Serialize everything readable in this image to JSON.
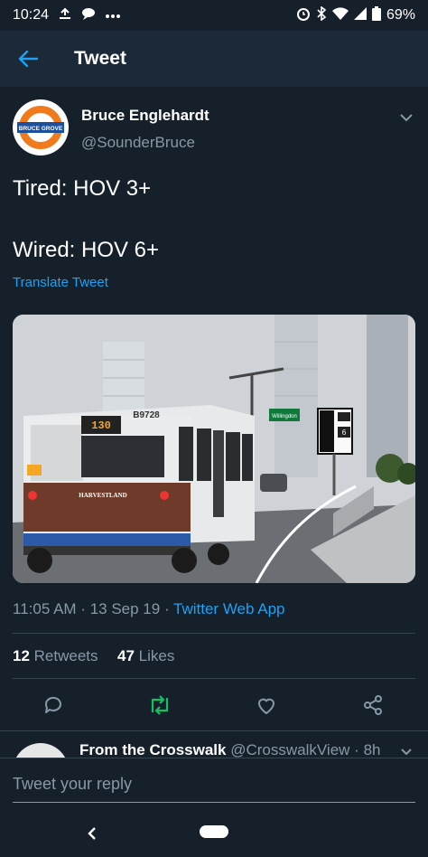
{
  "status_bar": {
    "time": "10:24",
    "battery": "69%",
    "icons": [
      "upload-icon",
      "message-icon",
      "more-dots-icon",
      "alarm-icon",
      "bluetooth-icon",
      "wifi-icon",
      "signal-icon",
      "battery-icon"
    ]
  },
  "header": {
    "title": "Tweet"
  },
  "tweet": {
    "author_name": "Bruce Englehardt",
    "author_handle": "@SounderBruce",
    "avatar_text": "BRUCE GROVE",
    "text": "Tired: HOV 3+\n\nWired: HOV 6+",
    "translate_label": "Translate Tweet",
    "time": "11:05 AM",
    "date": "13 Sep 19",
    "source": "Twitter Web App",
    "retweets_count": "12",
    "retweets_label": "Retweets",
    "likes_count": "47",
    "likes_label": "Likes"
  },
  "media": {
    "bus_route": "130",
    "bus_number": "B9728",
    "ad_brand": "HARVESTLAND",
    "sign_text": "Willingdon",
    "sign_number": "6"
  },
  "reply_preview": {
    "name": "From the Crosswalk",
    "handle": "@CrosswalkView",
    "time": "8h"
  },
  "reply_bar": {
    "placeholder": "Tweet your reply"
  },
  "colors": {
    "background": "#15202b",
    "header": "#1c2938",
    "accent": "#1da1f2",
    "muted": "#8899a6",
    "retweet": "#17bf63"
  }
}
